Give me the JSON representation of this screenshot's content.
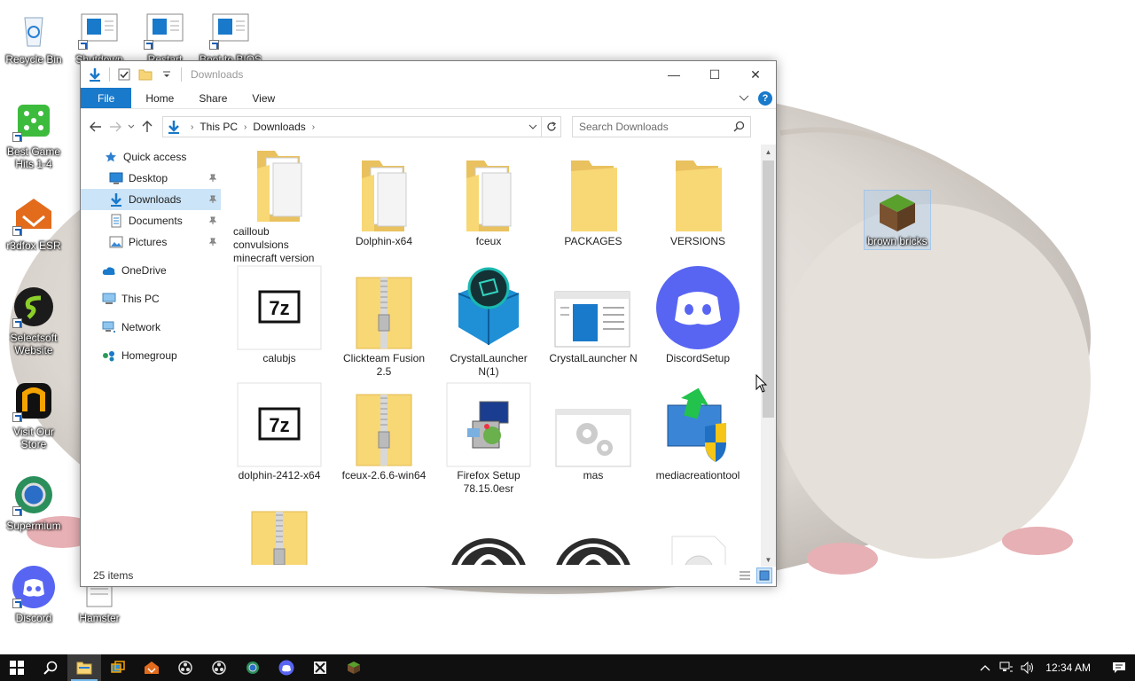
{
  "desktop": {
    "icons": [
      {
        "label": "Recycle Bin",
        "icon": "recycle-bin-icon"
      },
      {
        "label": "Shutdown",
        "icon": "window-icon"
      },
      {
        "label": "Restart",
        "icon": "window-icon"
      },
      {
        "label": "Boot to BIOS",
        "icon": "window-icon"
      },
      {
        "label": "Best Game Hits 1-4",
        "icon": "dice-icon"
      },
      {
        "label": "r3dfox ESR",
        "icon": "r3dfox-icon"
      },
      {
        "label": "Selectsoft Website",
        "icon": "selectsoft-icon"
      },
      {
        "label": "Visit Our Store",
        "icon": "store-icon"
      },
      {
        "label": "Supermium",
        "icon": "supermium-icon"
      },
      {
        "label": "Discord",
        "icon": "discord-icon"
      },
      {
        "label": "Hamster",
        "icon": "text-file-icon"
      },
      {
        "label": "brown bricks",
        "icon": "grass-block-icon"
      }
    ]
  },
  "window": {
    "title": "Downloads",
    "controls": {
      "minimize": "—",
      "maximize": "☐",
      "close": "✕"
    },
    "ribbon": {
      "tabs": [
        "File",
        "Home",
        "Share",
        "View"
      ]
    },
    "address": {
      "crumbs": [
        "This PC",
        "Downloads"
      ]
    },
    "search": {
      "placeholder": "Search Downloads"
    },
    "nav": {
      "quick_access": "Quick access",
      "items": [
        {
          "label": "Desktop",
          "pinned": true
        },
        {
          "label": "Downloads",
          "pinned": true,
          "selected": true
        },
        {
          "label": "Documents",
          "pinned": true
        },
        {
          "label": "Pictures",
          "pinned": true
        }
      ],
      "onedrive": "OneDrive",
      "this_pc": "This PC",
      "network": "Network",
      "homegroup": "Homegroup"
    },
    "files": [
      {
        "name": "cailloub convulsions minecraft version",
        "type": "folder-docs"
      },
      {
        "name": "Dolphin-x64",
        "type": "folder-docs"
      },
      {
        "name": "fceux",
        "type": "folder-docs"
      },
      {
        "name": "PACKAGES",
        "type": "folder"
      },
      {
        "name": "VERSIONS",
        "type": "folder"
      },
      {
        "name": "calubjs",
        "type": "7z"
      },
      {
        "name": "Clickteam Fusion 2.5",
        "type": "zip"
      },
      {
        "name": "CrystalLauncher N(1)",
        "type": "crystal"
      },
      {
        "name": "CrystalLauncher N",
        "type": "window"
      },
      {
        "name": "DiscordSetup",
        "type": "discord"
      },
      {
        "name": "dolphin-2412-x64",
        "type": "7z"
      },
      {
        "name": "fceux-2.6.6-win64",
        "type": "zip"
      },
      {
        "name": "Firefox Setup 78.15.0esr",
        "type": "setup"
      },
      {
        "name": "mas",
        "type": "gears"
      },
      {
        "name": "mediacreationtool",
        "type": "mediatool"
      },
      {
        "name": "",
        "type": "zip"
      },
      {
        "name": "",
        "type": "photo"
      },
      {
        "name": "",
        "type": "obs"
      },
      {
        "name": "",
        "type": "obs"
      },
      {
        "name": "",
        "type": "disc"
      }
    ],
    "status": {
      "count": "25 items"
    }
  },
  "taskbar": {
    "clock": "12:34 AM",
    "apps": [
      "start-icon",
      "search-icon",
      "file-explorer-icon",
      "task-view-icon",
      "r3dfox-icon",
      "obs-icon",
      "obs-icon",
      "supermium-icon",
      "discord-icon",
      "app-icon",
      "minecraft-icon"
    ]
  },
  "colors": {
    "accent": "#1979ca",
    "selection": "#cce4f7",
    "taskbar": "#101010"
  }
}
